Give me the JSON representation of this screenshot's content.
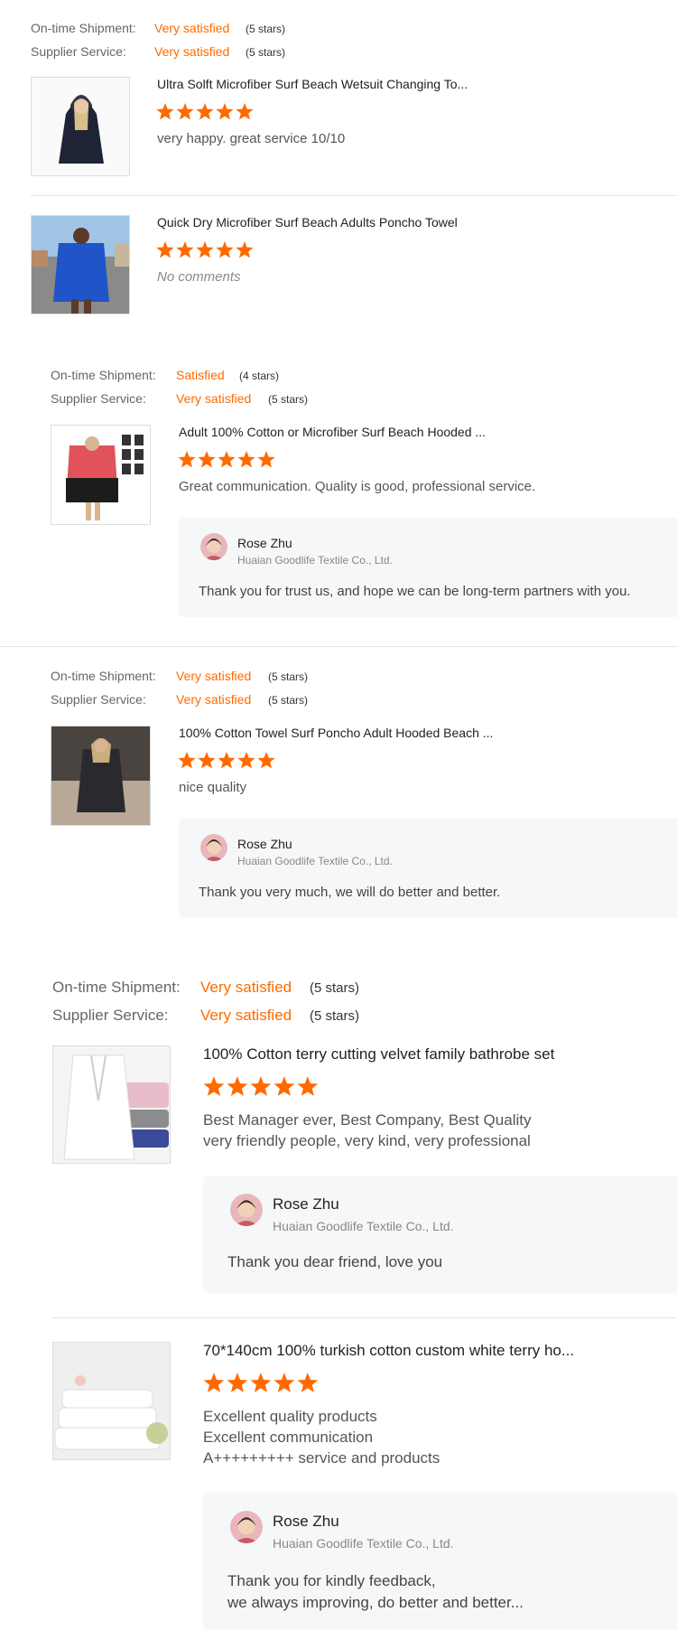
{
  "labels": {
    "shipment": "On-time Shipment:",
    "service": "Supplier Service:"
  },
  "reviews": [
    {
      "shipment_value": "Very satisfied",
      "shipment_stars": "(5 stars)",
      "service_value": "Very satisfied",
      "service_stars": "(5 stars)",
      "product_title": "Ultra Solft Microfiber Surf Beach Wetsuit Changing To...",
      "rating": 5,
      "comment": "very happy. great service 10/10"
    },
    {
      "product_title": "Quick Dry Microfiber Surf Beach Adults Poncho Towel",
      "rating": 5,
      "comment": "No comments"
    },
    {
      "shipment_value": "Satisfied",
      "shipment_stars": "(4 stars)",
      "service_value": "Very satisfied",
      "service_stars": "(5 stars)",
      "product_title": "Adult 100% Cotton or Microfiber Surf Beach Hooded ...",
      "rating": 5,
      "comment": "Great communication. Quality is good, professional service.",
      "reply": {
        "name": "Rose Zhu",
        "company": "Huaian Goodlife Textile Co., Ltd.",
        "text": "Thank you for trust us, and hope we can be long-term partners with you."
      }
    },
    {
      "shipment_value": "Very satisfied",
      "shipment_stars": "(5 stars)",
      "service_value": "Very satisfied",
      "service_stars": "(5 stars)",
      "product_title": "100% Cotton Towel Surf Poncho Adult Hooded Beach ...",
      "rating": 5,
      "comment": "nice quality",
      "reply": {
        "name": "Rose Zhu",
        "company": "Huaian Goodlife Textile Co., Ltd.",
        "text": "Thank you very much, we will do better and better."
      }
    },
    {
      "shipment_value": "Very satisfied",
      "shipment_stars": "(5 stars)",
      "service_value": "Very satisfied",
      "service_stars": "(5 stars)",
      "product_title": "100% Cotton terry cutting velvet family bathrobe set",
      "rating": 5,
      "comment_lines": [
        "Best Manager ever, Best Company, Best Quality",
        "very friendly people, very kind, very professional"
      ],
      "reply": {
        "name": "Rose Zhu",
        "company": "Huaian Goodlife Textile Co., Ltd.",
        "text": "Thank you dear friend, love you"
      }
    },
    {
      "product_title": "70*140cm 100% turkish cotton custom white terry ho...",
      "rating": 5,
      "comment_lines": [
        "Excellent quality products",
        "Excellent communication",
        "A+++++++++ service and products"
      ],
      "reply": {
        "name": "Rose Zhu",
        "company": "Huaian Goodlife Textile Co., Ltd.",
        "text_lines": [
          "Thank you for kindly feedback,",
          "we always improving, do better and better..."
        ]
      }
    }
  ],
  "colors": {
    "accent": "#ff6a00",
    "reply_bg": "#f6f7f9"
  },
  "icons": {
    "star": "star-icon",
    "avatar": "avatar"
  }
}
